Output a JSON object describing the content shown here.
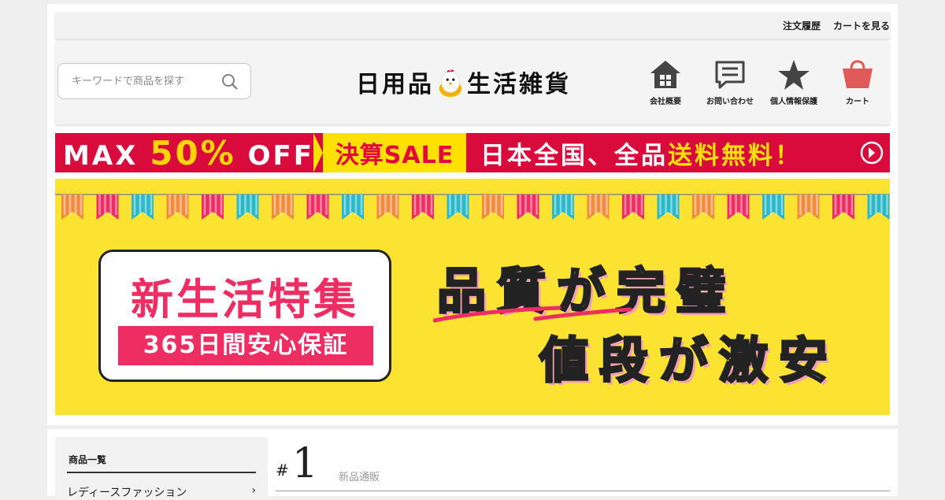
{
  "topbar": {
    "links": [
      "注文履歴",
      "カートを見る"
    ]
  },
  "search": {
    "placeholder": "キーワードで商品を探す"
  },
  "logo": {
    "left": "日用品",
    "right": "生活雑貨"
  },
  "nav": {
    "items": [
      {
        "label": "会社概要",
        "icon": "house-icon"
      },
      {
        "label": "お問い合わせ",
        "icon": "chat-icon"
      },
      {
        "label": "個人情報保護",
        "icon": "star-icon"
      },
      {
        "label": "カート",
        "icon": "cart-icon"
      }
    ]
  },
  "sale_banner": {
    "max": "MAX",
    "percent": "50%",
    "off": "OFF",
    "event": "決算SALE",
    "shipping_prefix": "日本全国、全品",
    "shipping_highlight": "送料無料！",
    "colors": {
      "red": "#d90a3c",
      "yellow": "#ffe100"
    }
  },
  "hero": {
    "title": "新生活特集",
    "guarantee": "365日間安心保証",
    "slogan_line1": "品質が完璧",
    "slogan_line2": "値段が激安",
    "colors": {
      "background": "#fde331",
      "pink": "#ee2d62"
    }
  },
  "sidebar": {
    "title": "商品一覧",
    "items": [
      "レディースファッション"
    ]
  },
  "ranking": {
    "hash": "#",
    "number": "1",
    "label": "新品通販"
  }
}
